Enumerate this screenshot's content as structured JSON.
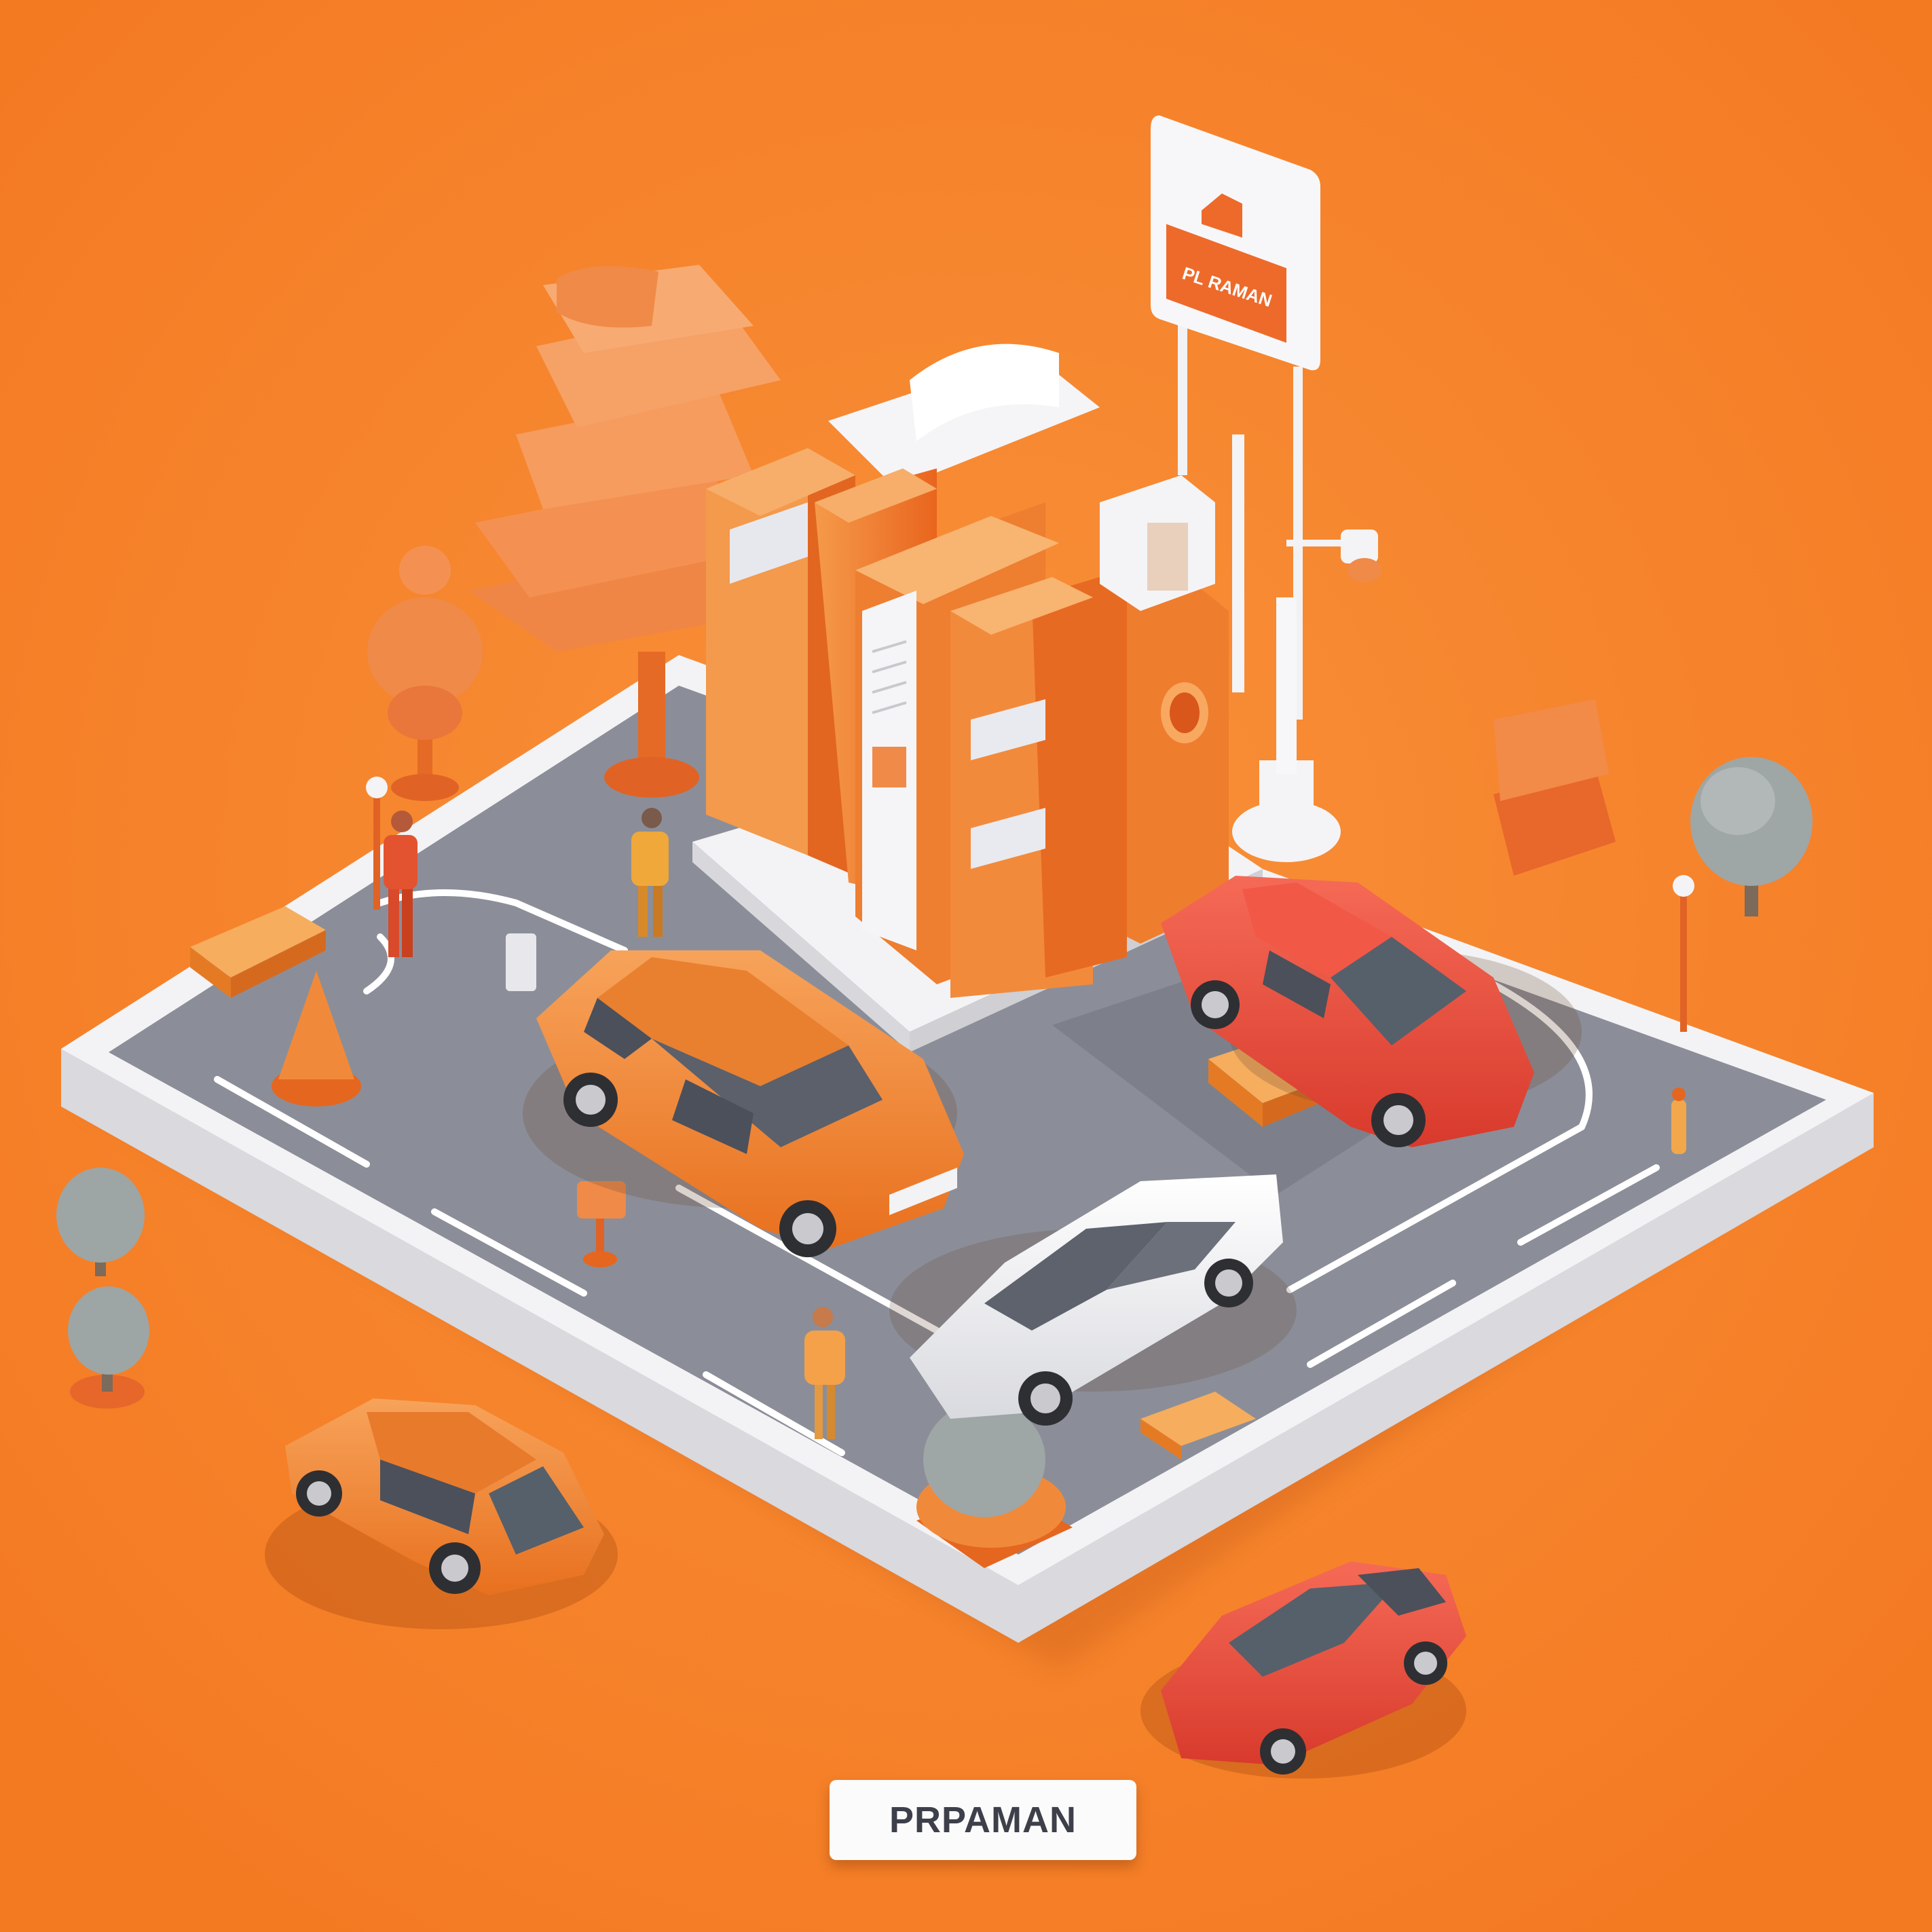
{
  "image": {
    "kind": "isometric 3D illustration",
    "subject": "gas station on a road tile with cars, people, trees and a sign"
  },
  "sign": {
    "text": "PL RAMAN"
  },
  "label": {
    "text": "PRPAMAN"
  },
  "colors": {
    "background": "#f7892f",
    "platform": "#f2f2f4",
    "road": "#8a8d97",
    "road_marking": "#ffffff",
    "building": "#f07a2a",
    "car_orange": "#f08a3a",
    "car_red": "#e9473a",
    "car_white": "#f4f4f6",
    "tree": "#9aa0a0"
  },
  "objects": {
    "cars": [
      "orange-sedan",
      "red-sedan",
      "white-sedan",
      "orange-wagon",
      "red-sedan-front"
    ],
    "people_count": 4
  }
}
